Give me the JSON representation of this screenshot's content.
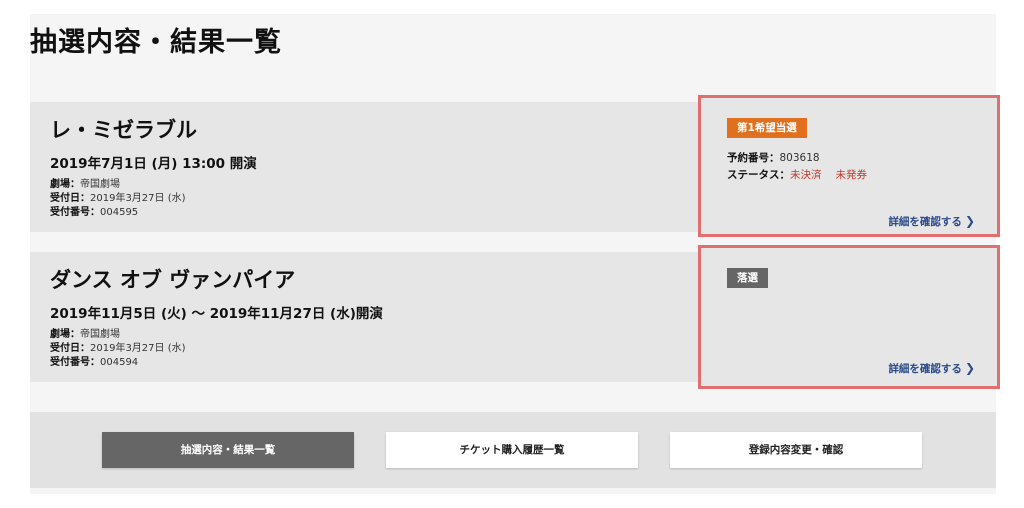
{
  "page": {
    "title": "抽選内容・結果一覧"
  },
  "entries": [
    {
      "title": "レ・ミゼラブル",
      "date": "2019年7月1日 (月) 13:00 開演",
      "venue_label": "劇場：",
      "venue": "帝国劇場",
      "received_label": "受付日：",
      "received": "2019年3月27日 (水)",
      "number_label": "受付番号：",
      "number": "004595",
      "result": {
        "badge": "第1希望当選",
        "badge_color": "#e0701d",
        "reservation_label": "予約番号：",
        "reservation": "803618",
        "status_label": "ステータス：",
        "status_payment": "未決済",
        "status_ticket": "未発券",
        "detail_link": "詳細を確認する"
      }
    },
    {
      "title": "ダンス オブ ヴァンパイア",
      "date": "2019年11月5日 (火) ～ 2019年11月27日 (水)開演",
      "venue_label": "劇場：",
      "venue": "帝国劇場",
      "received_label": "受付日：",
      "received": "2019年3月27日 (水)",
      "number_label": "受付番号：",
      "number": "004594",
      "result": {
        "badge": "落選",
        "badge_color": "#666666",
        "detail_link": "詳細を確認する"
      }
    }
  ],
  "footer": {
    "buttons": [
      {
        "label": "抽選内容・結果一覧",
        "active": true
      },
      {
        "label": "チケット購入履歴一覧",
        "active": false
      },
      {
        "label": "登録内容変更・確認",
        "active": false
      }
    ]
  },
  "colors": {
    "highlight_border": "#e07070",
    "status_red": "#c0392b",
    "link_blue": "#2a4a8a"
  }
}
